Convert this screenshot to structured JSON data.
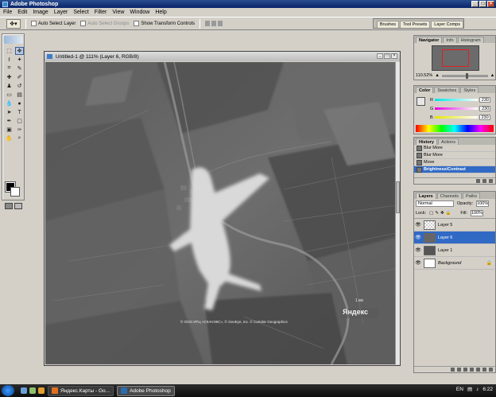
{
  "window": {
    "title": "Adobe Photoshop"
  },
  "menu": [
    "File",
    "Edit",
    "Image",
    "Layer",
    "Select",
    "Filter",
    "View",
    "Window",
    "Help"
  ],
  "options": {
    "auto_select_layer": "Auto Select Layer",
    "auto_select_groups": "Auto Select Groups",
    "show_transform_controls": "Show Transform Controls"
  },
  "palette_well": [
    "Brushes",
    "Tool Presets",
    "Layer Comps"
  ],
  "document": {
    "title": "Untitled-1 @ 111% (Layer 6, RGB/8)",
    "map_attribution": "© ООО ИТЦ «СКАНЭКС», © GeoEye, Inc. © Cartolar Geographics",
    "yandex_logo": "Яндекс",
    "scale_label": "1 км"
  },
  "navigator": {
    "tabs": [
      "Navigator",
      "Info",
      "Histogram"
    ],
    "zoom": "110.52%"
  },
  "color_panel": {
    "tabs": [
      "Color",
      "Swatches",
      "Styles"
    ],
    "channels": [
      {
        "label": "R",
        "value": "230"
      },
      {
        "label": "G",
        "value": "230"
      },
      {
        "label": "B",
        "value": "230"
      }
    ]
  },
  "history": {
    "tabs": [
      "History",
      "Actions"
    ],
    "items": [
      "Blur More",
      "Blur More",
      "Move",
      "Brightness/Contrast"
    ],
    "active_index": 3
  },
  "layers": {
    "tabs": [
      "Layers",
      "Channels",
      "Paths"
    ],
    "blend_mode": "Normal",
    "opacity_label": "Opacity:",
    "opacity": "100%",
    "lock_label": "Lock:",
    "fill_label": "Fill:",
    "fill": "100%",
    "items": [
      {
        "name": "Layer 5"
      },
      {
        "name": "Layer 6"
      },
      {
        "name": "Layer 1"
      },
      {
        "name": "Background"
      }
    ],
    "active_index": 1
  },
  "taskbar": {
    "tasks": [
      {
        "label": "Яндекс.Карты - Go..."
      },
      {
        "label": "Adobe Photoshop"
      }
    ],
    "language": "EN",
    "time": "6:22"
  }
}
